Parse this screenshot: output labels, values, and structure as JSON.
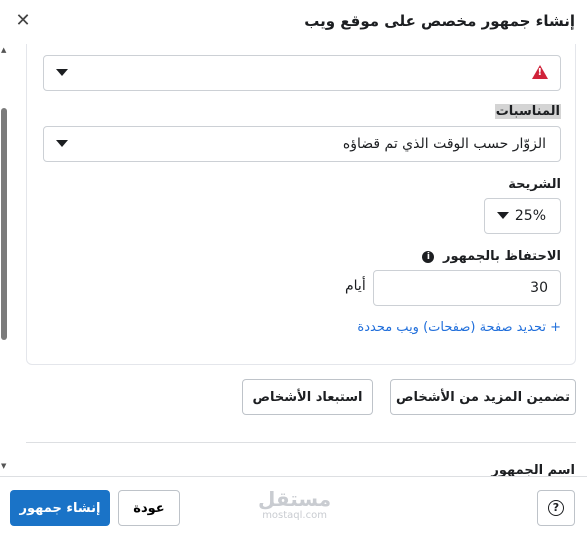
{
  "dialog": {
    "title": "إنشاء جمهور مخصص على موقع ويب",
    "close_icon": "close-icon"
  },
  "form": {
    "top_select": {
      "value": "",
      "status": "error",
      "icon": "warning-triangle-icon"
    },
    "occasions": {
      "label": "المناسبات",
      "value": "الزوّار حسب الوقت الذي تم قضاؤه"
    },
    "segment": {
      "label": "الشريحة",
      "value": "25%"
    },
    "retention": {
      "label": "الاحتفاظ بالجمهور",
      "info_icon": "info-icon",
      "value": "30",
      "unit": "أيام"
    },
    "refine_link": "+ تحديد صفحة (صفحات) ويب محددة"
  },
  "actions": {
    "include_more": "تضمين المزيد من الأشخاص",
    "exclude": "استبعاد الأشخاص"
  },
  "audience_name": {
    "label": "اسم الجمهور"
  },
  "footer": {
    "help_icon": "help-icon",
    "watermark_ar": "مستقل",
    "watermark_en": "mostaql.com",
    "back_label": "عودة",
    "create_label": "إنشاء جمهور"
  },
  "colors": {
    "primary": "#1a73c7",
    "link": "#216fdb",
    "error": "#d0233a"
  }
}
